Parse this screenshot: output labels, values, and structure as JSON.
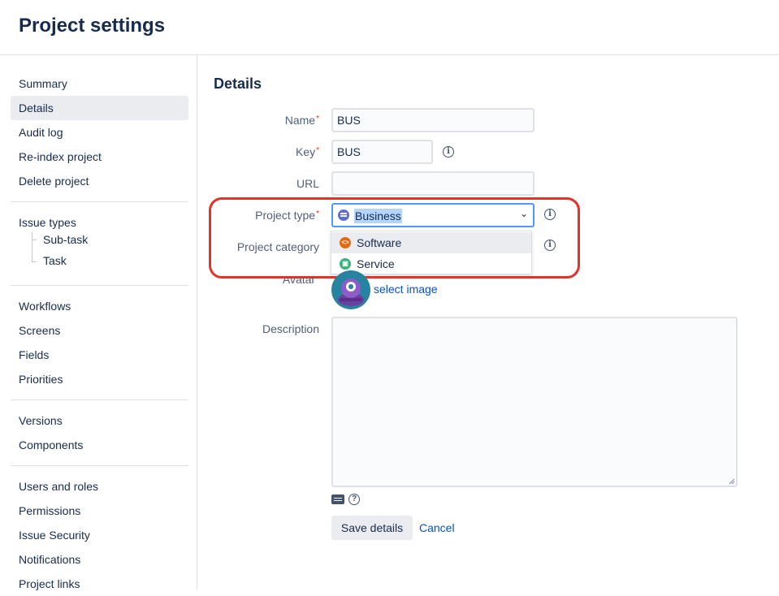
{
  "page_title": "Project settings",
  "sidebar": {
    "group1": [
      "Summary",
      "Details",
      "Audit log",
      "Re-index project",
      "Delete project"
    ],
    "issue_types": {
      "label": "Issue types",
      "children": [
        "Sub-task",
        "Task"
      ]
    },
    "group3": [
      "Workflows",
      "Screens",
      "Fields",
      "Priorities"
    ],
    "group4": [
      "Versions",
      "Components"
    ],
    "group5": [
      "Users and roles",
      "Permissions",
      "Issue Security",
      "Notifications",
      "Project links"
    ],
    "selected": "Details"
  },
  "details": {
    "title": "Details",
    "name": {
      "label": "Name",
      "value": "BUS"
    },
    "key": {
      "label": "Key",
      "value": "BUS"
    },
    "url": {
      "label": "URL",
      "value": ""
    },
    "project_type": {
      "label": "Project type",
      "value": "Business",
      "options": [
        "Software",
        "Service"
      ]
    },
    "project_category": {
      "label": "Project category"
    },
    "avatar": {
      "label": "Avatar",
      "link": "select image"
    },
    "description": {
      "label": "Description",
      "value": ""
    },
    "save_label": "Save details",
    "cancel_label": "Cancel"
  },
  "colors": {
    "highlight": "#e5332a",
    "link": "#0052cc",
    "business_icon": "#5e6cd8",
    "software_icon": "#e56910",
    "service_icon": "#36b37e"
  }
}
